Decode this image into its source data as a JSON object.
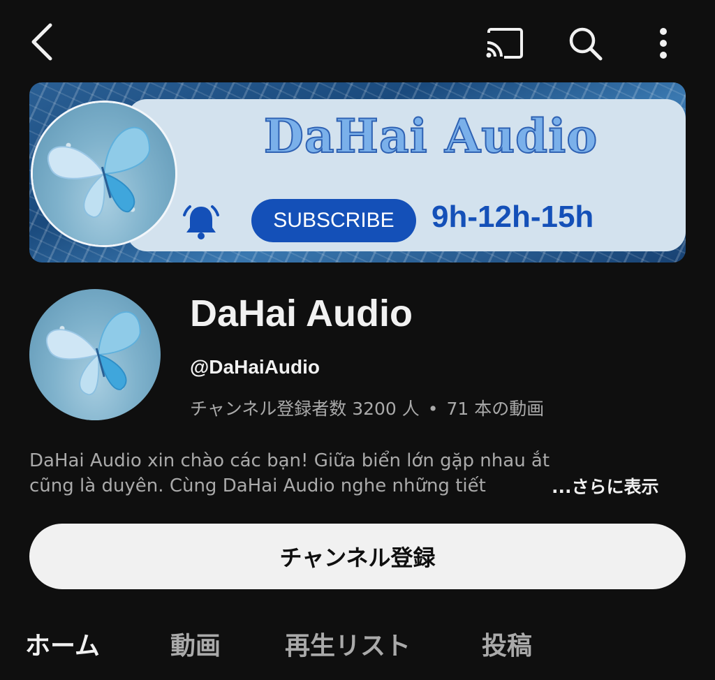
{
  "topbar": {
    "icons": [
      "back-icon",
      "cast-icon",
      "search-icon",
      "more-vert-icon"
    ]
  },
  "banner": {
    "title": "DaHai Audio",
    "subscribe_label": "SUBSCRIBE",
    "schedule": "9h-12h-15h",
    "colors": {
      "title_fill": "#7ab0ea",
      "title_outline": "#2f62b3",
      "pill": "#1450b8",
      "card": "#d3e2ee"
    }
  },
  "channel": {
    "name": "DaHai Audio",
    "handle": "@DaHaiAudio",
    "subscribers": "チャンネル登録者数 3200 人",
    "separator": "•",
    "videos": "71 本の動画",
    "description_line1": "DaHai Audio xin chào các bạn! Giữa biển lớn gặp nhau ắt",
    "description_line2": "cũng là duyên. Cùng DaHai Audio nghe những tiết",
    "more_label": "...さらに表示"
  },
  "subscribe_button": {
    "label": "チャンネル登録"
  },
  "tabs": [
    {
      "label": "ホーム",
      "active": true
    },
    {
      "label": "動画",
      "active": false
    },
    {
      "label": "再生リスト",
      "active": false
    },
    {
      "label": "投稿",
      "active": false
    }
  ]
}
